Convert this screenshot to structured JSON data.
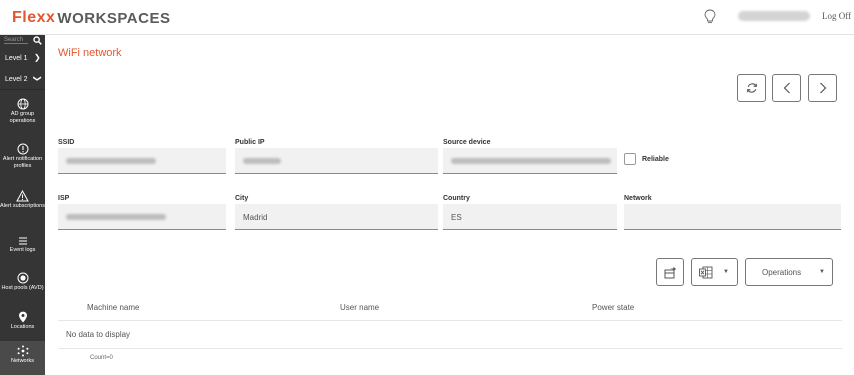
{
  "header": {
    "logo_part1": "Fle",
    "logo_part2": "xx",
    "logo_part3": "WORKSPACES",
    "logoff_label": "Log Off"
  },
  "sidebar": {
    "search_label": "Search",
    "level1": "Level 1",
    "level2": "Level 2",
    "items": [
      {
        "label": "AD group operations",
        "icon": "globe-icon"
      },
      {
        "label": "Alert notification profiles",
        "icon": "alert-circle-icon"
      },
      {
        "label": "Alert subscriptions",
        "icon": "warning-triangle-icon"
      },
      {
        "label": "Event logs",
        "icon": "list-icon"
      },
      {
        "label": "Host pools (AVD)",
        "icon": "host-pool-icon"
      },
      {
        "label": "Locations",
        "icon": "map-pin-icon"
      },
      {
        "label": "Networks",
        "icon": "network-icon"
      }
    ]
  },
  "page": {
    "title": "WiFi network"
  },
  "fields": {
    "ssid_label": "SSID",
    "public_ip_label": "Public IP",
    "source_device_label": "Source device",
    "reliable_label": "Reliable",
    "isp_label": "ISP",
    "city_label": "City",
    "city_value": "Madrid",
    "country_label": "Country",
    "country_value": "ES",
    "network_label": "Network"
  },
  "toolbar": {
    "operations_label": "Operations"
  },
  "table": {
    "columns": [
      "Machine name",
      "User name",
      "Power state"
    ],
    "empty_text": "No data to display",
    "count_text": "Count=0"
  },
  "colors": {
    "accent": "#e4572e",
    "sidebar_bg": "#353535"
  }
}
